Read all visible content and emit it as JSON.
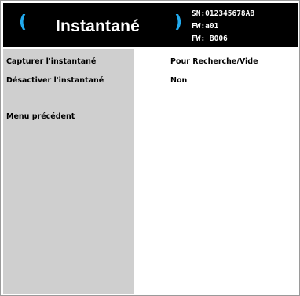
{
  "header": {
    "title": "Instantané",
    "left_glyph": "(",
    "right_glyph": ")",
    "serial": "SN:012345678AB",
    "fw_line1": "FW:a01",
    "fw_line2": "FW: B006",
    "accent_color": "#22aaee"
  },
  "menu": {
    "items": [
      {
        "label": "Capturer l'instantané",
        "value": "Pour Recherche/Vide"
      },
      {
        "label": "Désactiver l'instantané",
        "value": "Non"
      },
      {
        "label": "Menu précédent",
        "value": ""
      }
    ]
  }
}
